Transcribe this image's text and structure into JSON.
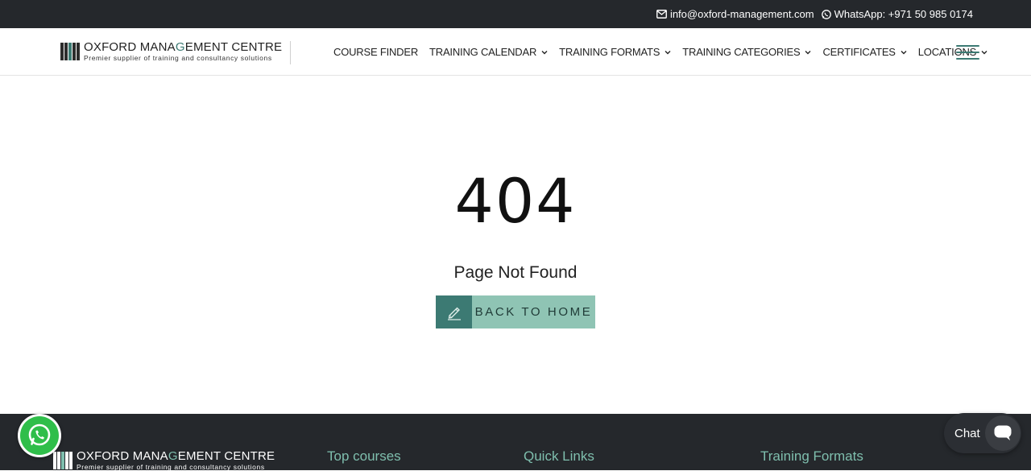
{
  "topbar": {
    "email": "info@oxford-management.com",
    "whatsapp": "WhatsApp: +971 50 985 0174"
  },
  "brand": {
    "title_part1": "OXFORD MANA",
    "title_g": "G",
    "title_part2": "EMENT CENTRE",
    "tagline": "Premier supplier of training and consultancy solutions"
  },
  "nav": {
    "items": [
      {
        "label": "COURSE FINDER",
        "has_dropdown": false
      },
      {
        "label": "TRAINING CALENDAR",
        "has_dropdown": true
      },
      {
        "label": "TRAINING FORMATS",
        "has_dropdown": true
      },
      {
        "label": "TRAINING CATEGORIES",
        "has_dropdown": true
      },
      {
        "label": "CERTIFICATES",
        "has_dropdown": true
      },
      {
        "label": "LOCATIONS",
        "has_dropdown": true
      }
    ],
    "menu_icon": "hamburger-icon"
  },
  "error": {
    "code": "404",
    "message": "Page Not Found",
    "button_label": "BACK TO HOME",
    "button_icon": "pencil-icon"
  },
  "footer": {
    "headings": [
      "Top courses",
      "Quick Links",
      "Training Formats"
    ]
  },
  "chat": {
    "label": "Chat"
  },
  "colors": {
    "dark": "#25282c",
    "teal": "#3c7a73",
    "light_teal": "#8fc4b4",
    "footer_heading": "#7fbfae",
    "whatsapp_green": "#2fbe4a"
  }
}
